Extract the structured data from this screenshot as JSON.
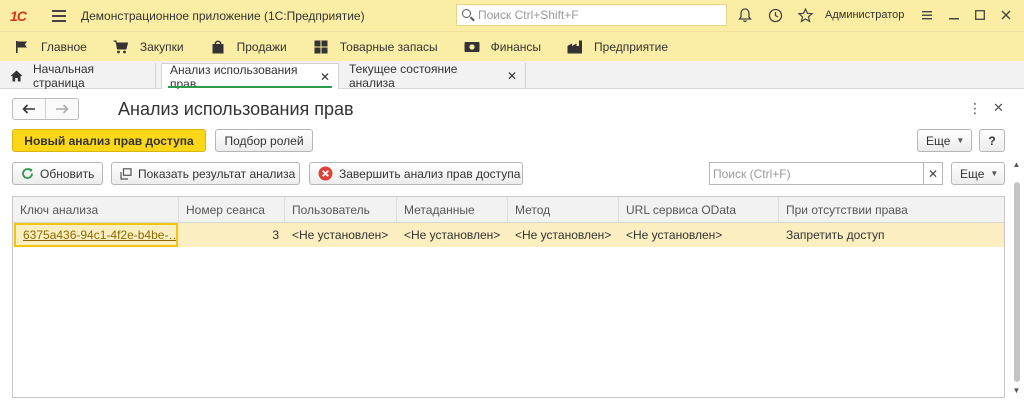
{
  "titlebar": {
    "logo": "1С",
    "title": "Демонстрационное приложение  (1С:Предприятие)",
    "search_placeholder": "Поиск Ctrl+Shift+F",
    "user": "Администратор"
  },
  "sections": [
    {
      "label": "Главное",
      "icon": "flag-icon"
    },
    {
      "label": "Закупки",
      "icon": "cart-icon"
    },
    {
      "label": "Продажи",
      "icon": "bag-icon"
    },
    {
      "label": "Товарные запасы",
      "icon": "grid-icon"
    },
    {
      "label": "Финансы",
      "icon": "money-icon"
    },
    {
      "label": "Предприятие",
      "icon": "factory-icon"
    }
  ],
  "tabs": [
    {
      "label": "Начальная страница"
    },
    {
      "label": "Анализ использования прав"
    },
    {
      "label": "Текущее состояние анализа"
    }
  ],
  "form": {
    "title": "Анализ использования прав",
    "new_analysis_button": "Новый анализ прав доступа",
    "role_selection_button": "Подбор ролей",
    "more_button_top": "Еще",
    "help_button": "?",
    "refresh_button": "Обновить",
    "show_result_button": "Показать результат анализа",
    "finish_analysis_button": "Завершить анализ прав доступа",
    "search_placeholder": "Поиск (Ctrl+F)",
    "more_button_table": "Еще"
  },
  "table": {
    "columns": [
      "Ключ анализа",
      "Номер сеанса",
      "Пользователь",
      "Метаданные",
      "Метод",
      "URL сервиса OData",
      "При отсутствии права"
    ],
    "rows": [
      [
        "6375a436-94c1-4f2e-b4be-…",
        "3",
        "<Не установлен>",
        "<Не установлен>",
        "<Не установлен>",
        "<Не установлен>",
        "Запретить доступ"
      ]
    ]
  },
  "colors": {
    "accent_yellow": "#fcd718",
    "header_bg": "#fbeea4",
    "selected_row": "#fbeec1",
    "active_tab_underline": "#2e9a4b"
  }
}
